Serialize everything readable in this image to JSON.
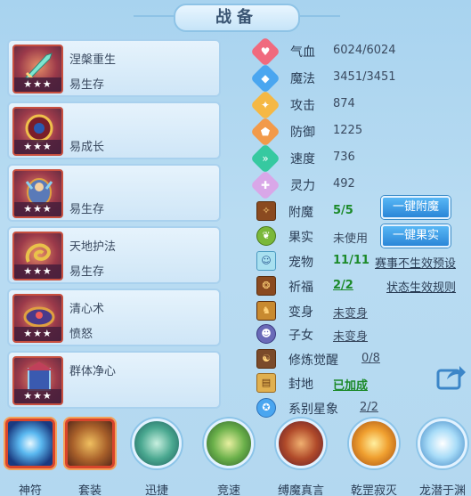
{
  "title": "战备",
  "skills": [
    {
      "name": "涅槃重生",
      "effect": "易生存",
      "stars": "★★★",
      "icon": "sword-icon"
    },
    {
      "name": "",
      "effect": "易成长",
      "stars": "★★★",
      "icon": "armor-icon"
    },
    {
      "name": "",
      "effect": "易生存",
      "stars": "★★★",
      "icon": "warrior-icon"
    },
    {
      "name": "天地护法",
      "effect": "易生存",
      "stars": "★★★",
      "icon": "serpent-icon"
    },
    {
      "name": "清心术",
      "effect": "愤怒",
      "stars": "★★★",
      "icon": "crown-icon"
    },
    {
      "name": "群体净心",
      "effect": "",
      "stars": "★★★",
      "icon": "shrine-icon"
    }
  ],
  "stats": [
    {
      "label": "气血",
      "value": "6024/6024",
      "color": "#f06a7e",
      "icon": "heart-icon"
    },
    {
      "label": "魔法",
      "value": "3451/3451",
      "color": "#4aa6f0",
      "icon": "mana-icon"
    },
    {
      "label": "攻击",
      "value": "874",
      "color": "#f5b844",
      "icon": "attack-icon"
    },
    {
      "label": "防御",
      "value": "1225",
      "color": "#f29a4a",
      "icon": "defense-icon"
    },
    {
      "label": "速度",
      "value": "736",
      "color": "#36c9a0",
      "icon": "speed-icon"
    },
    {
      "label": "灵力",
      "value": "492",
      "color": "#d9a7e8",
      "icon": "spirit-icon"
    }
  ],
  "misc": {
    "enchant": {
      "label": "附魔",
      "value": "5/5"
    },
    "fruit": {
      "label": "果实",
      "value": "未使用"
    },
    "pet": {
      "label": "宠物",
      "value": "11/11"
    },
    "bless": {
      "label": "祈福",
      "value": "2/2"
    },
    "transform": {
      "label": "变身",
      "value": "未变身"
    },
    "child": {
      "label": "子女",
      "value": "未变身"
    },
    "awaken": {
      "label": "修炼觉醒",
      "value": "0/8"
    },
    "fief": {
      "label": "封地",
      "value": "已加成"
    },
    "zodiac": {
      "label": "系别星象",
      "value": "2/2"
    }
  },
  "buttons": {
    "enchant_all": "一键附魔",
    "fruit_all": "一键果实",
    "race_preview": "赛事不生效预设",
    "status_rules": "状态生效规则"
  },
  "tabs": [
    {
      "label": "神符",
      "active": true
    },
    {
      "label": "套装",
      "active": true
    },
    {
      "label": "迅捷",
      "active": false
    },
    {
      "label": "竞速",
      "active": false
    },
    {
      "label": "缚魔真言",
      "active": false
    },
    {
      "label": "乾罡寂灭",
      "active": false
    },
    {
      "label": "龙潜于渊",
      "active": false
    }
  ]
}
